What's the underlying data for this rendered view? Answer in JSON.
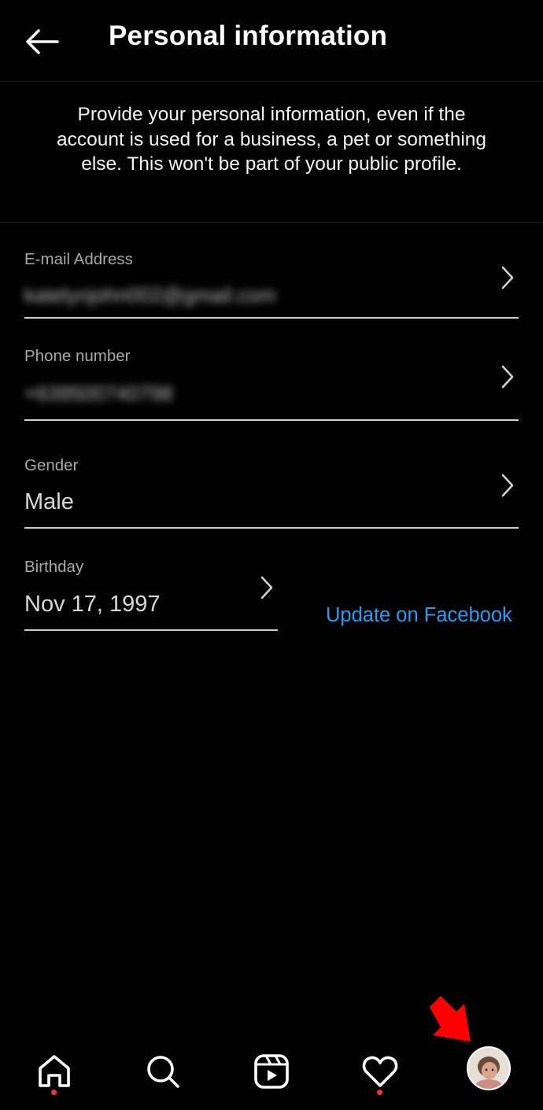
{
  "header": {
    "title": "Personal information"
  },
  "intro": {
    "text": "Provide your personal information, even if the account is used for a business, a pet or something else. This won't be part of your public profile."
  },
  "fields": {
    "email": {
      "label": "E-mail Address",
      "value": "katelynjohn002@gmail.com"
    },
    "phone": {
      "label": "Phone number",
      "value": "+639500740798"
    },
    "gender": {
      "label": "Gender",
      "value": "Male"
    },
    "birthday": {
      "label": "Birthday",
      "value": "Nov 17, 1997",
      "link": "Update on Facebook"
    }
  },
  "colors": {
    "background": "#000000",
    "link": "#2b9cf0",
    "notification_dot": "#ff3040",
    "annotation_arrow": "#ff0000"
  },
  "bottom_nav": {
    "items": [
      {
        "icon": "home-icon",
        "has_dot": true
      },
      {
        "icon": "search-icon",
        "has_dot": false
      },
      {
        "icon": "reels-icon",
        "has_dot": false
      },
      {
        "icon": "heart-icon",
        "has_dot": true
      },
      {
        "icon": "profile-avatar",
        "has_dot": false
      }
    ]
  }
}
